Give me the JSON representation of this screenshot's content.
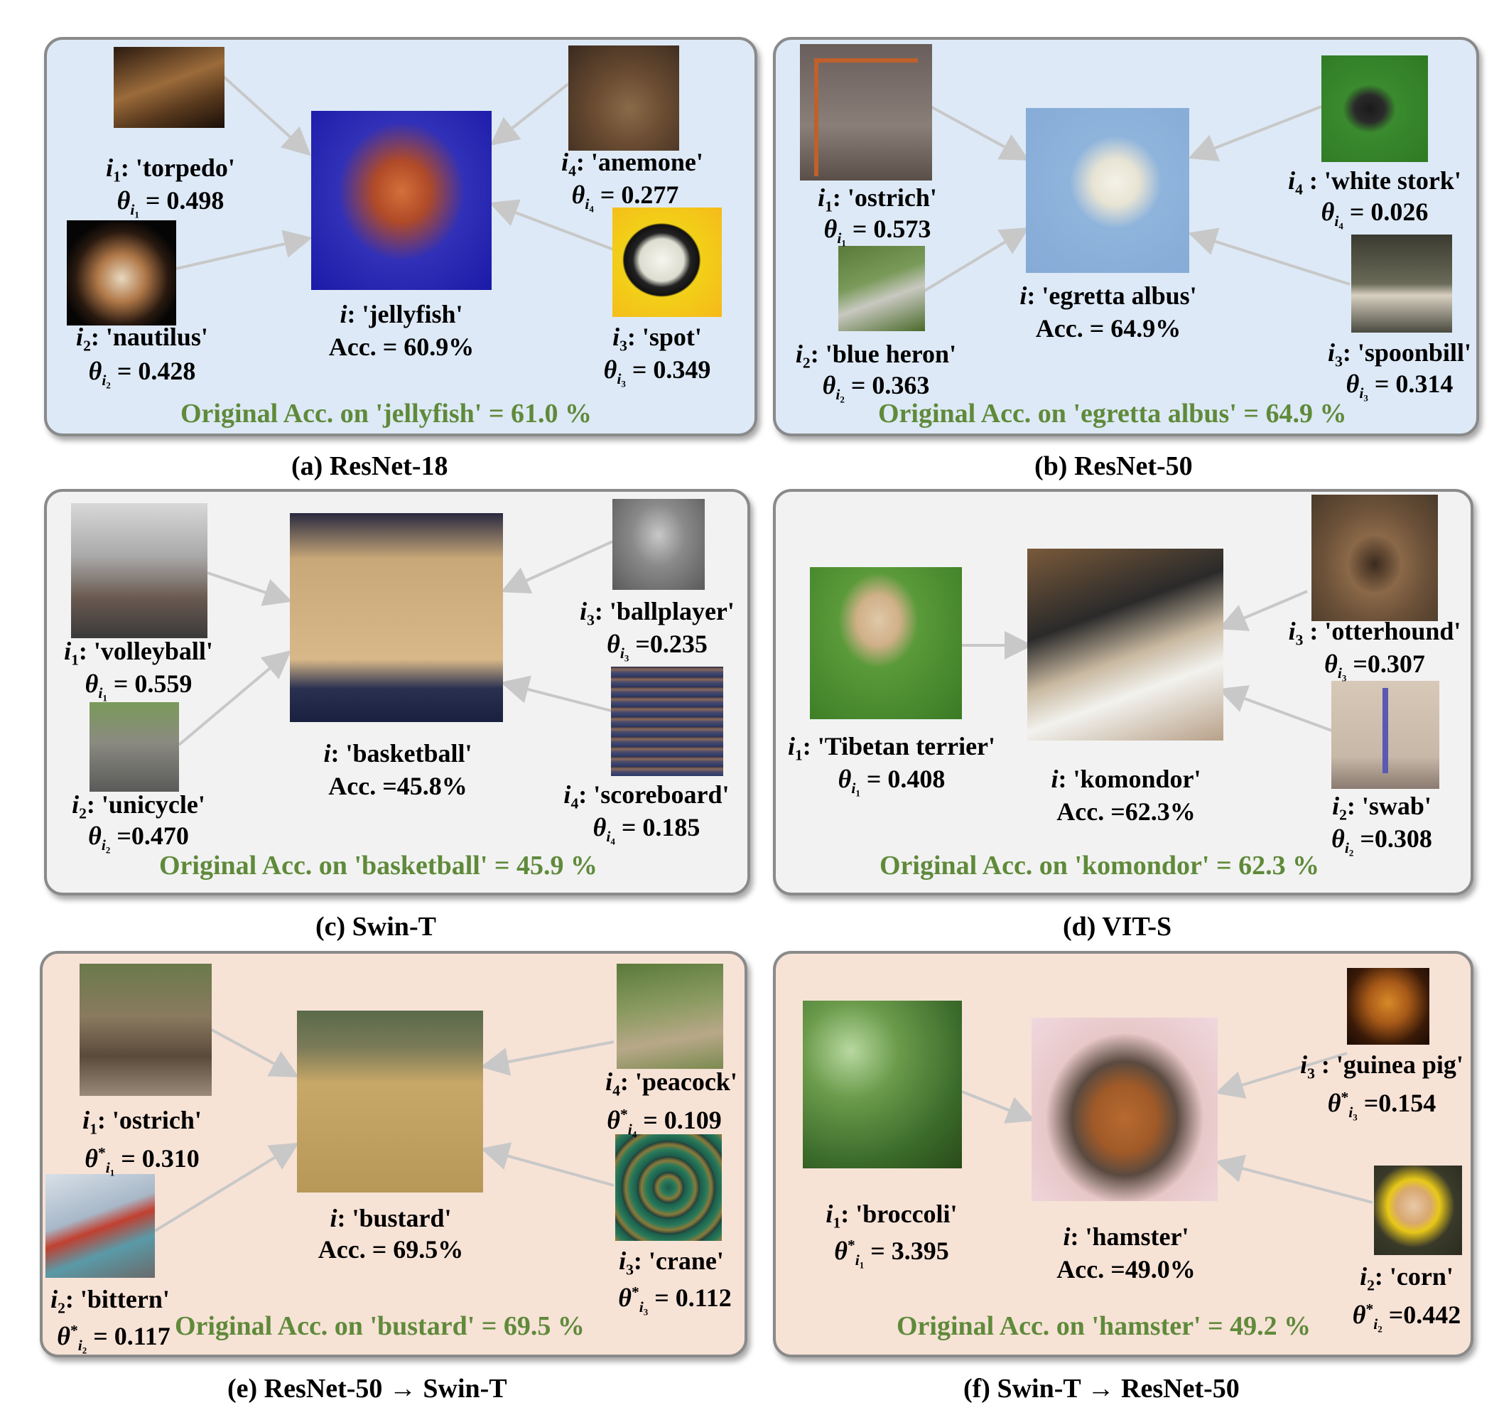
{
  "panels": [
    {
      "caption": "(a) ResNet-18",
      "center": {
        "sym": "i",
        "class": "'jellyfish'",
        "acc": "Acc. = 60.9%"
      },
      "original": "Original Acc. on 'jellyfish' = 61.0 %",
      "items": [
        {
          "sub": "1",
          "class": "'torpedo'",
          "theta": "= 0.498"
        },
        {
          "sub": "2",
          "class": "'nautilus'",
          "theta": "= 0.428"
        },
        {
          "sub": "3",
          "class": "'spot'",
          "theta": "= 0.349"
        },
        {
          "sub": "4",
          "class": "'anemone'",
          "theta": "= 0.277"
        }
      ]
    },
    {
      "caption": "(b) ResNet-50",
      "center": {
        "sym": "i",
        "class": "'egretta albus'",
        "acc": "Acc. = 64.9%"
      },
      "original": "Original Acc. on 'egretta albus' = 64.9 %",
      "items": [
        {
          "sub": "1",
          "class": "'ostrich'",
          "theta": "= 0.573"
        },
        {
          "sub": "2",
          "class": "'blue heron'",
          "theta": "= 0.363"
        },
        {
          "sub": "3",
          "class": "'spoonbill'",
          "theta": "= 0.314"
        },
        {
          "sub": "4",
          "class": "'white stork'",
          "theta": "= 0.026"
        }
      ]
    },
    {
      "caption": "(c) Swin-T",
      "center": {
        "sym": "i",
        "class": "'basketball'",
        "acc": "Acc. =45.8%"
      },
      "original": "Original Acc. on 'basketball' = 45.9 %",
      "items": [
        {
          "sub": "1",
          "class": "'volleyball'",
          "theta": "= 0.559"
        },
        {
          "sub": "2",
          "class": "'unicycle'",
          "theta": "=0.470"
        },
        {
          "sub": "3",
          "class": "'ballplayer'",
          "theta": "=0.235"
        },
        {
          "sub": "4",
          "class": "'scoreboard'",
          "theta": "= 0.185"
        }
      ]
    },
    {
      "caption": "(d) VIT-S",
      "center": {
        "sym": "i",
        "class": "'komondor'",
        "acc": "Acc. =62.3%"
      },
      "original": "Original Acc. on 'komondor' = 62.3 %",
      "items": [
        {
          "sub": "1",
          "class": "'Tibetan terrier'",
          "theta": "= 0.408"
        },
        {
          "sub": "2",
          "class": "'swab'",
          "theta": "=0.308"
        },
        {
          "sub": "3",
          "class": "'otterhound'",
          "theta": "=0.307"
        }
      ]
    },
    {
      "caption": "(e) ResNet-50 → Swin-T",
      "center": {
        "sym": "i",
        "class": "'bustard'",
        "acc": "Acc. = 69.5%"
      },
      "original": "Original Acc. on 'bustard' = 69.5 %",
      "items": [
        {
          "sub": "1",
          "class": "'ostrich'",
          "theta": "= 0.310"
        },
        {
          "sub": "2",
          "class": "'bittern'",
          "theta": "= 0.117"
        },
        {
          "sub": "3",
          "class": "'crane'",
          "theta": "= 0.112"
        },
        {
          "sub": "4",
          "class": "'peacock'",
          "theta": "= 0.109"
        }
      ]
    },
    {
      "caption": "(f) Swin-T → ResNet-50",
      "center": {
        "sym": "i",
        "class": "'hamster'",
        "acc": "Acc. =49.0%"
      },
      "original": "Original Acc. on 'hamster' = 49.2 %",
      "items": [
        {
          "sub": "1",
          "class": "'broccoli'",
          "theta": "= 3.395"
        },
        {
          "sub": "2",
          "class": "'corn'",
          "theta": "=0.442"
        },
        {
          "sub": "3",
          "class": "'guinea pig'",
          "theta": "=0.154"
        }
      ]
    }
  ]
}
